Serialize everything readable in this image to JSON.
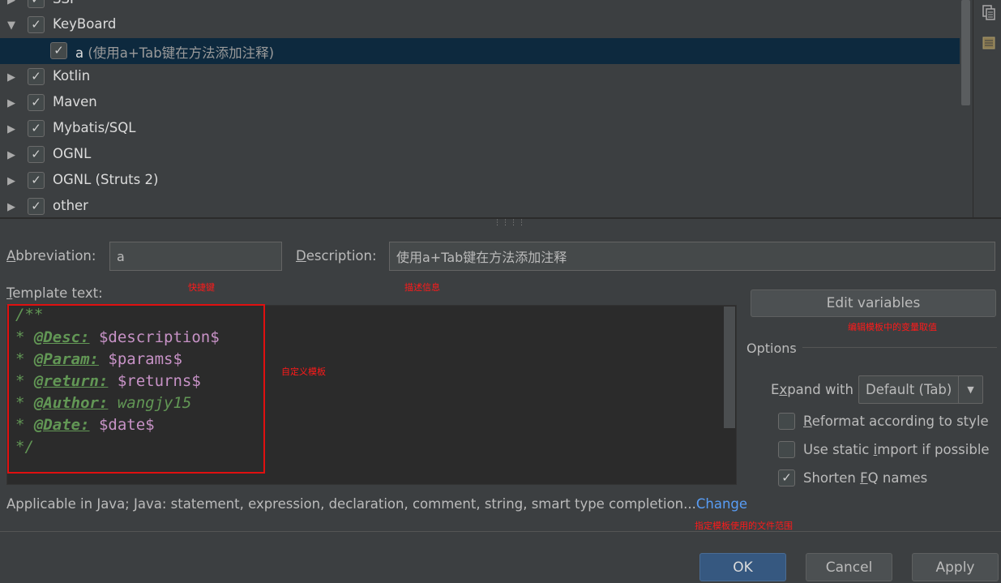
{
  "tree": {
    "items": [
      {
        "label": "SSI",
        "checked": true,
        "expanded": false
      },
      {
        "label": "KeyBoard",
        "checked": true,
        "expanded": true
      },
      {
        "label": "a",
        "desc": "(使用a+Tab键在方法添加注释)",
        "checked": true,
        "child": true,
        "selected": true
      },
      {
        "label": "Kotlin",
        "checked": true,
        "expanded": false
      },
      {
        "label": "Maven",
        "checked": true,
        "expanded": false
      },
      {
        "label": "Mybatis/SQL",
        "checked": true,
        "expanded": false
      },
      {
        "label": "OGNL",
        "checked": true,
        "expanded": false
      },
      {
        "label": "OGNL (Struts 2)",
        "checked": true,
        "expanded": false
      },
      {
        "label": "other",
        "checked": true,
        "expanded": false
      }
    ]
  },
  "form": {
    "abbreviation_label_prefix": "A",
    "abbreviation_label_rest": "bbreviation:",
    "abbreviation_value": "a",
    "description_label_prefix": "D",
    "description_label_rest": "escription:",
    "description_value": "使用a+Tab键在方法添加注释",
    "template_label_prefix": "T",
    "template_label_rest": "emplate text:"
  },
  "annotations": {
    "shortcut": "快捷键",
    "description_info": "描述信息",
    "custom_template": "自定义模板",
    "edit_vars": "编辑模板中的变量取值",
    "scope": "指定模板使用的文件范围"
  },
  "template": {
    "line1": "/**",
    "line2_star": "* ",
    "line2_tag": "@Desc:",
    "line2_var": " $description$",
    "line3_star": "* ",
    "line3_tag": "@Param:",
    "line3_var": " $params$",
    "line4_star": "* ",
    "line4_tag": "@return:",
    "line4_var": " $returns$",
    "line5_star": "* ",
    "line5_tag": "@Author:",
    "line5_val": " wangjy15",
    "line6_star": "* ",
    "line6_tag": "@Date:",
    "line6_var": " $date$",
    "line7": "*/"
  },
  "options": {
    "edit_variables_label": "Edit variables",
    "title": "Options",
    "expand_with_label_a": "E",
    "expand_with_label_b": "x",
    "expand_with_label_c": "pand with",
    "expand_with_value": "Default (Tab)",
    "reformat_label_a": "R",
    "reformat_label_b": "eformat according to style",
    "reformat_checked": false,
    "static_import_label_a": "Use static ",
    "static_import_label_b": "i",
    "static_import_label_c": "mport if possible",
    "static_import_checked": false,
    "shorten_label_a": "Shorten ",
    "shorten_label_b": "F",
    "shorten_label_c": "Q names",
    "shorten_checked": true
  },
  "applicable": {
    "text": "Applicable in Java; Java: statement, expression, declaration, comment, string, smart type completion...",
    "link": "Change"
  },
  "buttons": {
    "ok": "OK",
    "cancel": "Cancel",
    "apply": "Apply"
  }
}
